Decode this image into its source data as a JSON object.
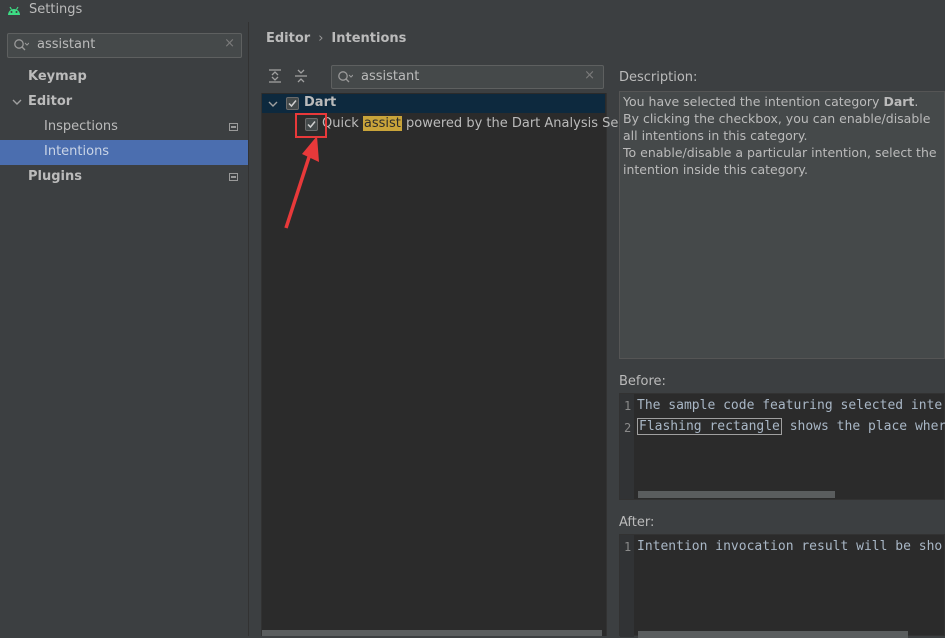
{
  "window": {
    "title": "Settings"
  },
  "sidebar": {
    "search_value": "assistant",
    "clear": "×",
    "items": [
      {
        "label": "Keymap"
      },
      {
        "label": "Editor"
      },
      {
        "label": "Inspections"
      },
      {
        "label": "Intentions"
      },
      {
        "label": "Plugins"
      }
    ]
  },
  "breadcrumb": {
    "part1": "Editor",
    "separator": "›",
    "part2": "Intentions"
  },
  "tree": {
    "search_value": "assistant",
    "clear": "×",
    "category": "Dart",
    "item_prefix": "Quick ",
    "item_highlight": "assist",
    "item_suffix": " powered by the Dart Analysis Server"
  },
  "description": {
    "label": "Description:",
    "line1_prefix": "You have selected the intention category ",
    "line1_bold": "Dart",
    "line1_suffix": ".",
    "line2": "By clicking the checkbox, you can enable/disable all intentions in this category.",
    "line3": "To enable/disable a particular intention, select the intention inside this category."
  },
  "before": {
    "label": "Before:",
    "line1_no": "1",
    "line1": "The sample code featuring selected inte",
    "line2_no": "2",
    "line2_flash": "Flashing rectangle",
    "line2_rest": " shows the place wher"
  },
  "after": {
    "label": "After:",
    "line1_no": "1",
    "line1": "Intention invocation result will be sho"
  }
}
